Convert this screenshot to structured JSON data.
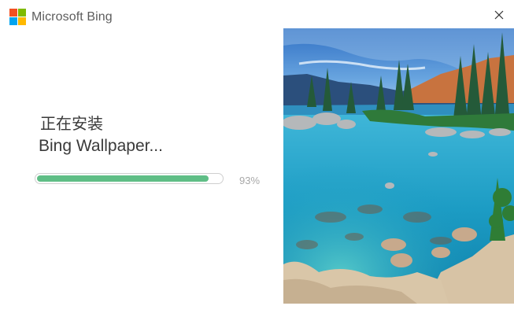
{
  "window": {
    "brand_name": "Microsoft Bing",
    "close_icon": "close-icon"
  },
  "brand_logo_colors": [
    "#f25022",
    "#7fba00",
    "#00a4ef",
    "#ffb900"
  ],
  "install": {
    "status_text": "正在安装",
    "product_name": "Bing Wallpaper...",
    "progress_fraction": 0.93,
    "progress_label": "93%",
    "progress_color": "#5fbe86"
  },
  "preview": {
    "image_icon": "wallpaper-preview-image"
  }
}
